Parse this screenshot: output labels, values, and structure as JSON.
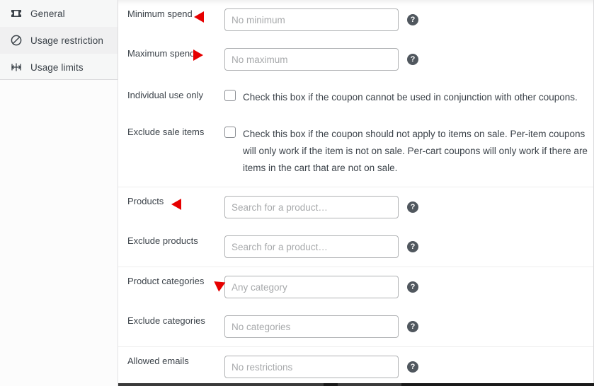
{
  "sidebar": {
    "items": [
      {
        "label": "General",
        "icon": "ticket-icon",
        "active": false
      },
      {
        "label": "Usage restriction",
        "icon": "prohibited-icon",
        "active": true
      },
      {
        "label": "Usage limits",
        "icon": "limits-icon",
        "active": false
      }
    ]
  },
  "help_glyph": "?",
  "form": {
    "groups": [
      {
        "rows": [
          {
            "type": "text",
            "label": "Minimum spend",
            "placeholder": "No minimum",
            "value": "",
            "help": true,
            "marker": "left"
          },
          {
            "type": "text",
            "label": "Maximum spend",
            "placeholder": "No maximum",
            "value": "",
            "help": true,
            "marker": "right"
          },
          {
            "type": "checkbox",
            "label": "Individual use only",
            "checked": false,
            "description": "Check this box if the coupon cannot be used in conjunction with other coupons."
          },
          {
            "type": "checkbox",
            "label": "Exclude sale items",
            "checked": false,
            "description": "Check this box if the coupon should not apply to items on sale. Per-item coupons will only work if the item is not on sale. Per-cart coupons will only work if there are items in the cart that are not on sale."
          }
        ]
      },
      {
        "rows": [
          {
            "type": "text",
            "label": "Products",
            "placeholder": "Search for a product…",
            "value": "",
            "help": true,
            "marker": "left"
          },
          {
            "type": "text",
            "label": "Exclude products",
            "placeholder": "Search for a product…",
            "value": "",
            "help": true,
            "marker": "none"
          }
        ]
      },
      {
        "rows": [
          {
            "type": "text",
            "label": "Product categories",
            "placeholder": "Any category",
            "value": "",
            "help": true,
            "marker": "downleft"
          },
          {
            "type": "text",
            "label": "Exclude categories",
            "placeholder": "No categories",
            "value": "",
            "help": true,
            "marker": "none"
          }
        ]
      },
      {
        "rows": [
          {
            "type": "text",
            "label": "Allowed emails",
            "placeholder": "No restrictions",
            "value": "",
            "help": true,
            "marker": "none"
          }
        ]
      }
    ]
  },
  "colors": {
    "marker_red": "#e60000",
    "sidebar_bg": "#f6f7f7",
    "active_bg": "#f0f0f1",
    "text": "#3c434a",
    "placeholder": "#a7a9ab",
    "border": "#dcdcde"
  }
}
